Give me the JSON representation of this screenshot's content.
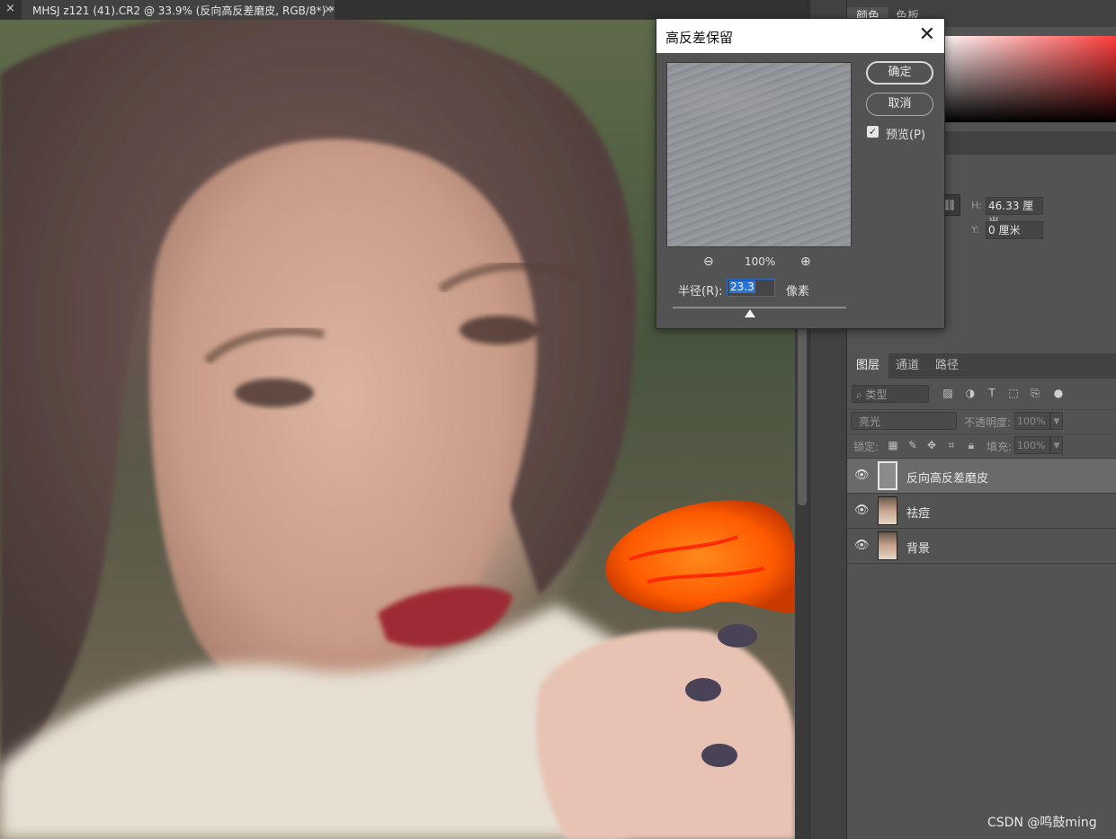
{
  "document": {
    "tab_title": "MHSJ z121 (41).CR2 @ 33.9% (反向高反差磨皮, RGB/8*) *",
    "tab_close": "×",
    "left_close": "×"
  },
  "panels": {
    "color_tabs": [
      "颜色",
      "色板"
    ],
    "properties": {
      "h_label": "H:",
      "h_value": "46.33 厘米",
      "y_label": "Y:",
      "y_value": "0 厘米"
    },
    "layers_tabs": [
      "图层",
      "通道",
      "路径"
    ],
    "filter_placeholder": "⌕ 类型",
    "blend_mode": "亮光",
    "opacity_label": "不透明度:",
    "opacity_value": "100%",
    "lock_label": "锁定:",
    "fill_label": "填充:",
    "fill_value": "100%",
    "layers": [
      {
        "name": "反向高反差磨皮",
        "selected": true
      },
      {
        "name": "祛痘",
        "selected": false
      },
      {
        "name": "背景",
        "selected": false
      }
    ]
  },
  "dialog": {
    "title": "高反差保留",
    "ok_label": "确定",
    "cancel_label": "取消",
    "preview_label": "预览(P)",
    "preview_checked": true,
    "zoom_level": "100%",
    "radius_label": "半径(R):",
    "radius_value": "23.3",
    "radius_unit": "像素"
  },
  "watermark": "CSDN @鸣鼓ming"
}
